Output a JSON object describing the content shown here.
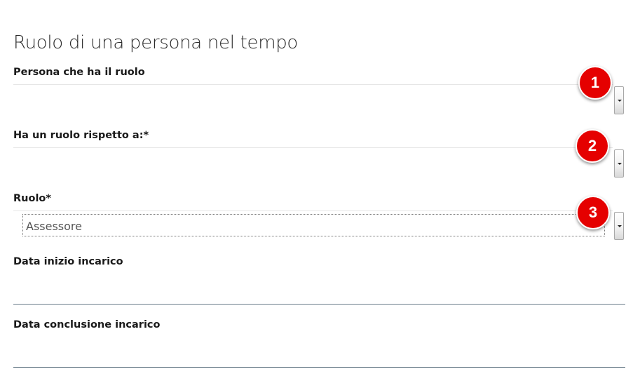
{
  "form": {
    "title": "Ruolo di una persona nel tempo",
    "fields": [
      {
        "label": "Persona che ha il ruolo",
        "value": ""
      },
      {
        "label": "Ha un ruolo rispetto a:*",
        "value": ""
      },
      {
        "label": "Ruolo*",
        "value": "Assessore"
      },
      {
        "label": "Data inizio incarico",
        "value": ""
      },
      {
        "label": "Data conclusione incarico",
        "value": ""
      }
    ]
  },
  "badges": [
    "1",
    "2",
    "3"
  ],
  "colors": {
    "badge": "#e50000",
    "underline": "#6b7d8a"
  }
}
